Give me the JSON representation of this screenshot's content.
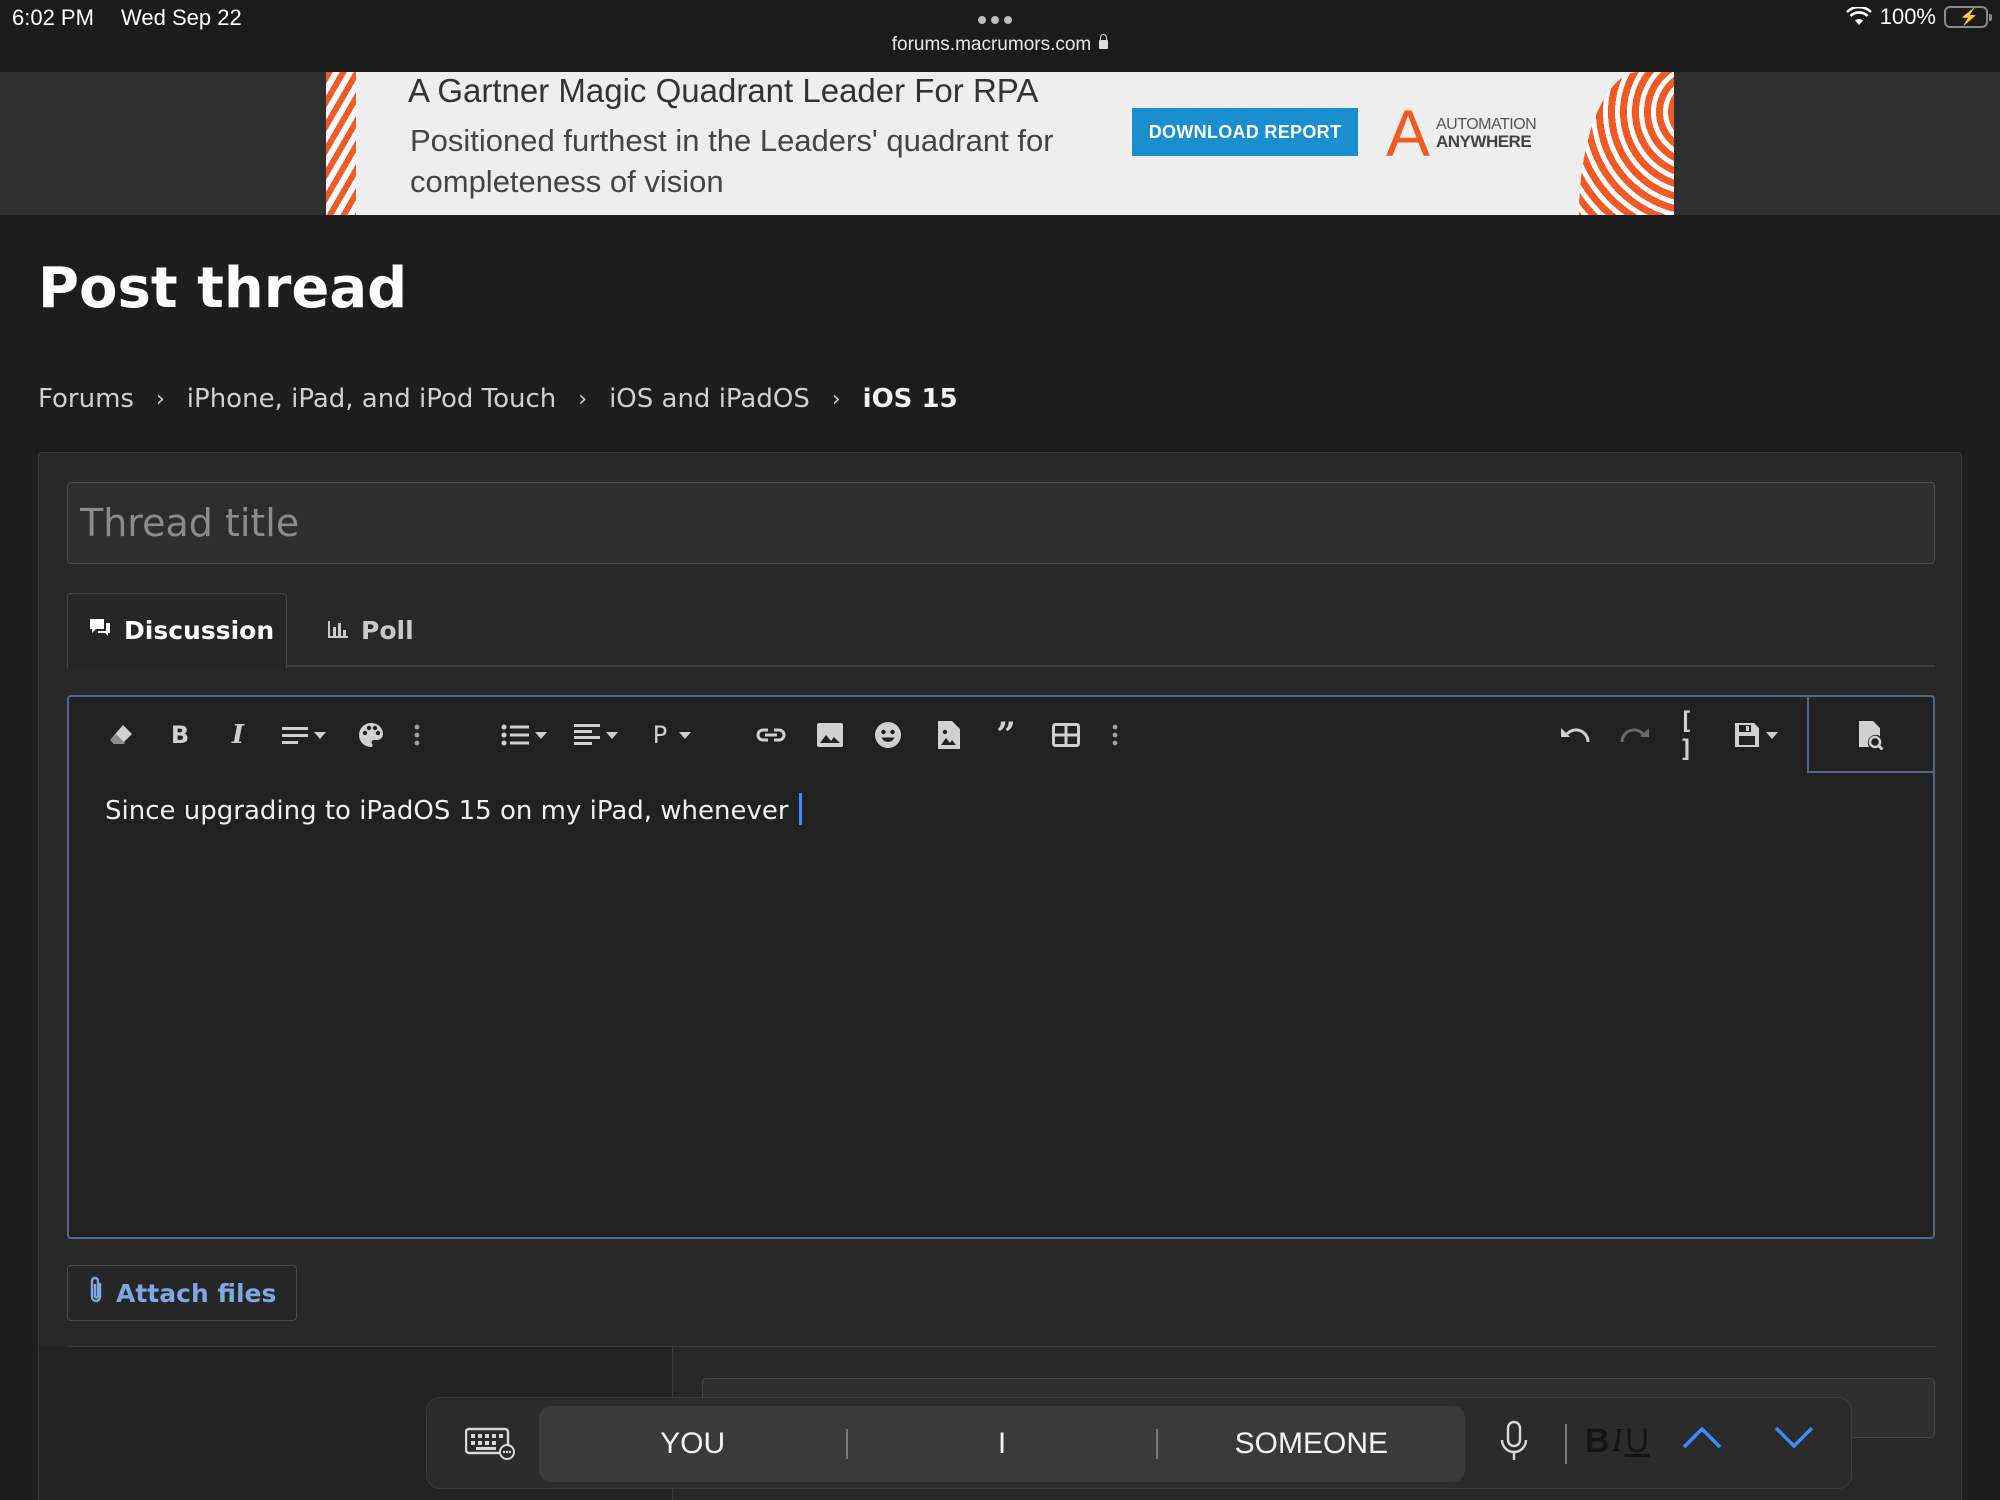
{
  "status_bar": {
    "time": "6:02 PM",
    "date": "Wed Sep 22",
    "url": "forums.macrumors.com",
    "battery": "100%"
  },
  "ad": {
    "headline": "A Gartner Magic Quadrant Leader For RPA",
    "subtext": "Positioned furthest in the Leaders' quadrant for completeness of vision",
    "button": "DOWNLOAD REPORT",
    "brand_line1": "AUTOMATION",
    "brand_line2": "ANYWHERE"
  },
  "page": {
    "title": "Post thread",
    "breadcrumb": [
      "Forums",
      "iPhone, iPad, and iPod Touch",
      "iOS and iPadOS",
      "iOS 15"
    ]
  },
  "form": {
    "title_placeholder": "Thread title",
    "tabs": [
      {
        "label": "Discussion",
        "icon": "speech-bubble-icon",
        "active": true
      },
      {
        "label": "Poll",
        "icon": "bar-chart-icon",
        "active": false
      }
    ],
    "editor_text": "Since upgrading to iPadOS 15 on my iPad, whenever ",
    "attach_label": "Attach files"
  },
  "keyboard_bar": {
    "suggestions": [
      "YOU",
      "I",
      "SOMEONE"
    ],
    "format_b": "B",
    "format_i": "I",
    "format_u": "U"
  },
  "colors": {
    "background": "#1d1d1d",
    "panel": "#282828",
    "accent_link": "#7fa7e6",
    "editor_focus": "#4a6a90",
    "ad_button": "#1a8fd0",
    "brand_orange": "#f15a24",
    "cursor": "#3d8bff"
  }
}
